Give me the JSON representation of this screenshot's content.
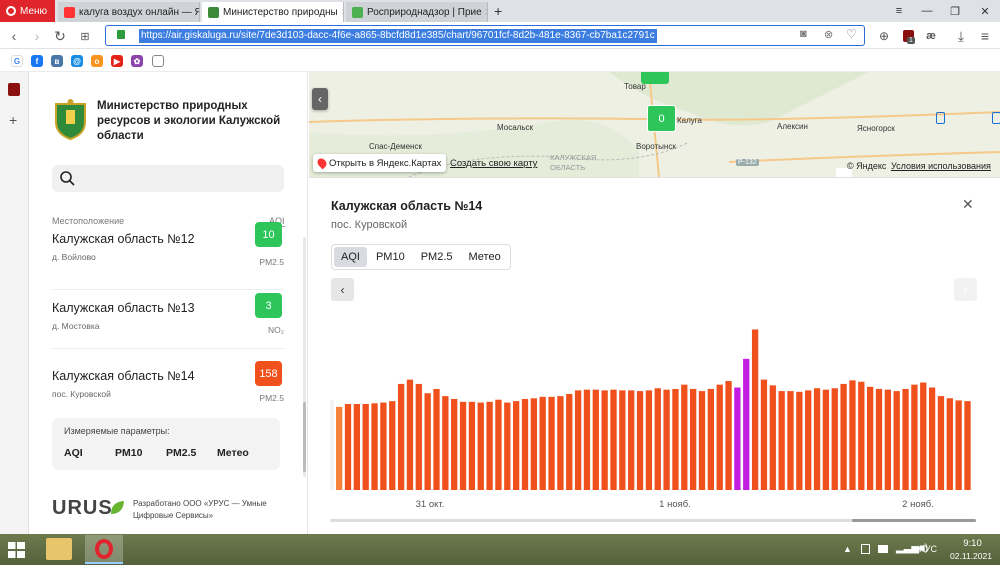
{
  "browser": {
    "menu_label": "Меню",
    "tabs": [
      {
        "label": "калуга воздух онлайн — Я",
        "active": false
      },
      {
        "label": "Министерство природны",
        "active": true
      },
      {
        "label": "Росприроднадзор | Прие",
        "active": false
      }
    ],
    "new_tab": "+",
    "url": "https://air.giskaluga.ru/site/7de3d103-dacc-4f6e-a865-8bcfd8d1e385/chart/96701fcf-8d2b-481e-8367-cb7ba1c2791c",
    "ext_badge": "1"
  },
  "site": {
    "org_title": "Министерство природных ресурсов и экологии Калужской области",
    "list_header": {
      "location": "Местоположение",
      "aqi": "AQI"
    },
    "stations": [
      {
        "name": "Калужская область №12",
        "locality": "д. Войлово",
        "value": "10",
        "param": "PM2.5",
        "color": "#2ec55a"
      },
      {
        "name": "Калужская область №13",
        "locality": "д. Мостовка",
        "value": "3",
        "param": "NO₂",
        "color": "#2ec55a"
      },
      {
        "name": "Калужская область №14",
        "locality": "пос. Куровской",
        "value": "158",
        "param": "PM2.5",
        "color": "#f0501c"
      }
    ],
    "measured": {
      "title": "Измеряемые параметры:",
      "items": [
        "AQI",
        "PM10",
        "PM2.5",
        "Метео"
      ]
    },
    "footer": {
      "logo": "URUS",
      "credit": "Разработано ООО «УРУС — Умные Цифровые Сервисы»"
    }
  },
  "map": {
    "labels": [
      "Товар",
      "Калуга",
      "Воротынск",
      "Мосальск",
      "Спас-Деменск",
      "КАЛУЖСКАЯ ОБЛАСТЬ",
      "Алексин",
      "Ясногорск",
      "Р-132"
    ],
    "marker_value": "0",
    "open_in_yandex": "Открыть в Яндекс.Картах",
    "create_map": "Создать свою карту",
    "copyright": "© Яндекс",
    "terms": "Условия использования"
  },
  "chart_panel": {
    "title": "Калужская область №14",
    "subtitle": "пос. Куровской",
    "tabs": [
      "AQI",
      "PM10",
      "PM2.5",
      "Метео"
    ],
    "active_tab": "AQI"
  },
  "chart_data": {
    "type": "bar",
    "x_ticks": [
      "31 окт.",
      "1 нояб.",
      "2 нояб."
    ],
    "values": [
      116,
      120,
      120,
      120,
      121,
      122,
      124,
      148,
      154,
      148,
      135,
      141,
      131,
      127,
      123,
      123,
      122,
      123,
      126,
      122,
      124,
      127,
      128,
      130,
      130,
      131,
      134,
      139,
      140,
      140,
      139,
      140,
      139,
      139,
      138,
      139,
      142,
      140,
      141,
      147,
      141,
      138,
      141,
      147,
      152,
      143,
      183,
      224,
      154,
      146,
      138,
      138,
      137,
      139,
      142,
      140,
      142,
      148,
      153,
      151,
      144,
      141,
      140,
      138,
      141,
      147,
      150,
      143,
      131,
      128,
      125,
      124
    ],
    "colors": {
      "good": "#f5813b",
      "unhealthy": "#f0501c",
      "very_unhealthy": "#c41de2"
    },
    "bar_colors": [
      "good",
      "unhealthy",
      "unhealthy",
      "unhealthy",
      "unhealthy",
      "unhealthy",
      "unhealthy",
      "unhealthy",
      "unhealthy",
      "unhealthy",
      "unhealthy",
      "unhealthy",
      "unhealthy",
      "unhealthy",
      "unhealthy",
      "unhealthy",
      "unhealthy",
      "unhealthy",
      "unhealthy",
      "unhealthy",
      "unhealthy",
      "unhealthy",
      "unhealthy",
      "unhealthy",
      "unhealthy",
      "unhealthy",
      "unhealthy",
      "unhealthy",
      "unhealthy",
      "unhealthy",
      "unhealthy",
      "unhealthy",
      "unhealthy",
      "unhealthy",
      "unhealthy",
      "unhealthy",
      "unhealthy",
      "unhealthy",
      "unhealthy",
      "unhealthy",
      "unhealthy",
      "unhealthy",
      "unhealthy",
      "unhealthy",
      "unhealthy",
      "very_unhealthy",
      "very_unhealthy",
      "unhealthy",
      "unhealthy",
      "unhealthy",
      "unhealthy",
      "unhealthy",
      "unhealthy",
      "unhealthy",
      "unhealthy",
      "unhealthy",
      "unhealthy",
      "unhealthy",
      "unhealthy",
      "unhealthy",
      "unhealthy",
      "unhealthy",
      "unhealthy",
      "unhealthy",
      "unhealthy",
      "unhealthy",
      "unhealthy",
      "unhealthy",
      "unhealthy",
      "unhealthy",
      "unhealthy"
    ],
    "ylim": [
      0,
      240
    ]
  },
  "taskbar": {
    "lang": "РУС",
    "time": "9:10",
    "date": "02.11.2021"
  }
}
